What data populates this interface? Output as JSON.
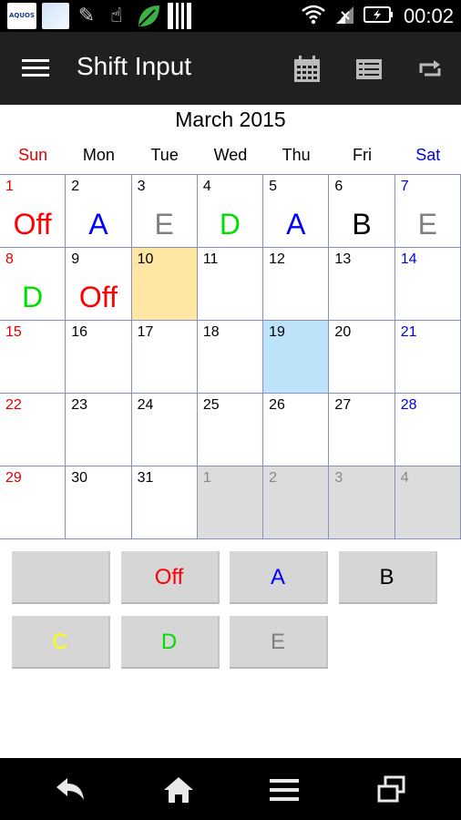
{
  "status_bar": {
    "time": "00:02",
    "aquos_label": "AQUOS"
  },
  "app_bar": {
    "title": "Shift Input"
  },
  "calendar": {
    "month_title": "March 2015",
    "weekdays": [
      {
        "label": "Sun",
        "color": "#e00000"
      },
      {
        "label": "Mon",
        "color": "#000000"
      },
      {
        "label": "Tue",
        "color": "#000000"
      },
      {
        "label": "Wed",
        "color": "#000000"
      },
      {
        "label": "Thu",
        "color": "#000000"
      },
      {
        "label": "Fri",
        "color": "#000000"
      },
      {
        "label": "Sat",
        "color": "#0000e0"
      }
    ],
    "days": [
      {
        "day": "1",
        "shift": "Off"
      },
      {
        "day": "2",
        "shift": "A"
      },
      {
        "day": "3",
        "shift": "E"
      },
      {
        "day": "4",
        "shift": "D"
      },
      {
        "day": "5",
        "shift": "A"
      },
      {
        "day": "6",
        "shift": "B"
      },
      {
        "day": "7",
        "shift": "E"
      },
      {
        "day": "8",
        "shift": "D"
      },
      {
        "day": "9",
        "shift": "Off"
      },
      {
        "day": "10",
        "shift": "",
        "highlight": "today"
      },
      {
        "day": "11",
        "shift": ""
      },
      {
        "day": "12",
        "shift": ""
      },
      {
        "day": "13",
        "shift": ""
      },
      {
        "day": "14",
        "shift": ""
      },
      {
        "day": "15",
        "shift": ""
      },
      {
        "day": "16",
        "shift": ""
      },
      {
        "day": "17",
        "shift": ""
      },
      {
        "day": "18",
        "shift": ""
      },
      {
        "day": "19",
        "shift": "",
        "highlight": "selected"
      },
      {
        "day": "20",
        "shift": ""
      },
      {
        "day": "21",
        "shift": ""
      },
      {
        "day": "22",
        "shift": ""
      },
      {
        "day": "23",
        "shift": ""
      },
      {
        "day": "24",
        "shift": ""
      },
      {
        "day": "25",
        "shift": ""
      },
      {
        "day": "26",
        "shift": ""
      },
      {
        "day": "27",
        "shift": ""
      },
      {
        "day": "28",
        "shift": ""
      },
      {
        "day": "29",
        "shift": ""
      },
      {
        "day": "30",
        "shift": ""
      },
      {
        "day": "31",
        "shift": ""
      },
      {
        "day": "1",
        "shift": "",
        "other_month": true
      },
      {
        "day": "2",
        "shift": "",
        "other_month": true
      },
      {
        "day": "3",
        "shift": "",
        "other_month": true
      },
      {
        "day": "4",
        "shift": "",
        "other_month": true
      }
    ]
  },
  "shift_buttons": [
    {
      "label": "",
      "color": "#000000"
    },
    {
      "label": "Off",
      "color": "#ff0000"
    },
    {
      "label": "A",
      "color": "#0000ff"
    },
    {
      "label": "B",
      "color": "#000000"
    },
    {
      "label": "C",
      "color": "#ffff00"
    },
    {
      "label": "D",
      "color": "#00dd00"
    },
    {
      "label": "E",
      "color": "#808080"
    }
  ],
  "shift_colors": {
    "Off": "#ff0000",
    "A": "#0000ff",
    "B": "#000000",
    "C": "#ffff00",
    "D": "#00dd00",
    "E": "#808080"
  },
  "highlight_colors": {
    "today": "#ffe6a3",
    "selected": "#bde3fb",
    "other_month": "#dcdcdc"
  },
  "icons": {
    "app_bar": [
      "menu-icon",
      "calendar-icon",
      "list-icon",
      "repeat-icon"
    ],
    "nav_bar": [
      "back-icon",
      "home-icon",
      "menu-icon",
      "recent-apps-icon"
    ]
  }
}
